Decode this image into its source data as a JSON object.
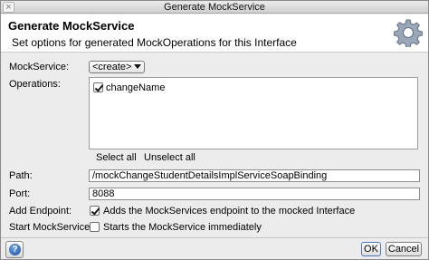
{
  "window": {
    "title": "Generate MockService"
  },
  "header": {
    "title": "Generate MockService",
    "subtitle": "Set options for generated MockOperations for this Interface"
  },
  "form": {
    "mockservice_label": "MockService:",
    "mockservice_value": "<create>",
    "operations_label": "Operations:",
    "operations": [
      {
        "label": "changeName",
        "checked": true
      }
    ],
    "select_all": "Select all",
    "unselect_all": "Unselect all",
    "path_label": "Path:",
    "path_value": "/mockChangeStudentDetailsImplServiceSoapBinding",
    "port_label": "Port:",
    "port_value": "8088",
    "add_endpoint_label": "Add Endpoint:",
    "add_endpoint_text": "Adds the MockServices endpoint to the mocked Interface",
    "add_endpoint_checked": true,
    "start_label": "Start MockService:",
    "start_text": "Starts the MockService immediately",
    "start_checked": false
  },
  "footer": {
    "help_icon": "help-icon",
    "help_glyph": "?",
    "ok_label": "OK",
    "cancel_label": "Cancel"
  }
}
